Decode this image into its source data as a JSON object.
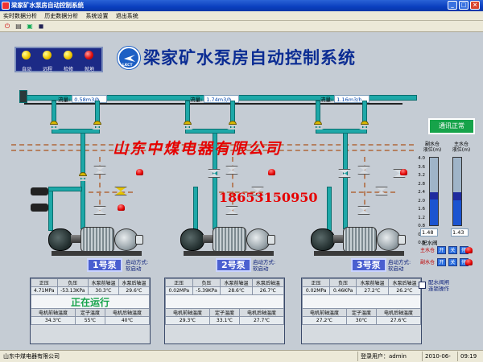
{
  "window": {
    "title": "梁家矿水泵房自动控制系统",
    "min": "_",
    "max": "□",
    "close": "×"
  },
  "menu": [
    "实时数据分析",
    "历史数据分析",
    "系统设置",
    "退出系统"
  ],
  "toolbar": {
    "icons": [
      "power-icon",
      "print-icon",
      "export-icon",
      "save-icon"
    ]
  },
  "header": {
    "title": "梁家矿水泵房自动控制系统",
    "logo_text": "LKCT"
  },
  "lamps": [
    {
      "label": "自动",
      "color": "#f0c800"
    },
    {
      "label": "远程",
      "color": "#f0c800"
    },
    {
      "label": "检修",
      "color": "#f0c800"
    },
    {
      "label": "就地",
      "color": "#e01010"
    }
  ],
  "flows": [
    {
      "label": "流量:",
      "value": "0.58m3/h"
    },
    {
      "label": "流量:",
      "value": "1.74m3/h"
    },
    {
      "label": "流量:",
      "value": "1.16m3/h"
    }
  ],
  "watermark": {
    "company": "山东中煤电器有限公司",
    "phone": "18653150950"
  },
  "pumps": [
    {
      "name": "1号泵",
      "start_mode_label": "启动方式:",
      "start_mode": "软启动",
      "headers1": [
        "正压",
        "负压",
        "水泵前轴温",
        "水泵后轴温"
      ],
      "values1": [
        "4.71MPa",
        "-53.13KPa",
        "30.3℃",
        "29.6℃"
      ],
      "status": "正在运行",
      "headers2": [
        "电机前轴温度",
        "定子温度",
        "电机后轴温度"
      ],
      "values2": [
        "34.3℃",
        "55℃",
        "40℃"
      ]
    },
    {
      "name": "2号泵",
      "start_mode_label": "启动方式:",
      "start_mode": "软启动",
      "headers1": [
        "正压",
        "负压",
        "水泵前轴温",
        "水泵后轴温"
      ],
      "values1": [
        "0.02MPa",
        "-5.39KPa",
        "28.6℃",
        "26.7℃"
      ],
      "status": "",
      "headers2": [
        "电机前轴温度",
        "定子温度",
        "电机后轴温度"
      ],
      "values2": [
        "29.3℃",
        "33.1℃",
        "27.7℃"
      ]
    },
    {
      "name": "3号泵",
      "start_mode_label": "启动方式:",
      "start_mode": "软启动",
      "headers1": [
        "正压",
        "负压",
        "水泵前轴温",
        "水泵后轴温"
      ],
      "values1": [
        "0.02MPa",
        "0.46KPa",
        "27.2℃",
        "26.2℃"
      ],
      "status": "",
      "headers2": [
        "电机前轴温度",
        "定子温度",
        "电机后轴温度"
      ],
      "values2": [
        "27.2℃",
        "30℃",
        "27.6℃"
      ]
    }
  ],
  "tanks": {
    "comm_status": "通讯正常",
    "left_label": "副水仓\n液位(m)",
    "right_label": "主水仓\n液位(m)",
    "scale": [
      "4.0",
      "3.6",
      "3.2",
      "2.8",
      "2.4",
      "2.0",
      "1.6",
      "1.2",
      "0.8",
      "0.4",
      "0.0"
    ],
    "left_value": "1.48",
    "right_value": "1.43",
    "left_level_m": 1.48,
    "right_level_m": 1.43,
    "scale_max_m": 4.0
  },
  "distribution": {
    "title": "配水阀",
    "rows": [
      {
        "label": "主水仓",
        "buttons": [
          "开",
          "关",
          "停"
        ]
      },
      {
        "label": "副水仓",
        "buttons": [
          "开",
          "关",
          "停"
        ]
      }
    ],
    "checkbox_label": "配水阀闸\n连锁操作"
  },
  "statusbar": {
    "company": "山东中煤电器有限公司",
    "user_label": "登录用户：",
    "user": "admin",
    "date": "2010-06-05",
    "time": "09:19"
  }
}
